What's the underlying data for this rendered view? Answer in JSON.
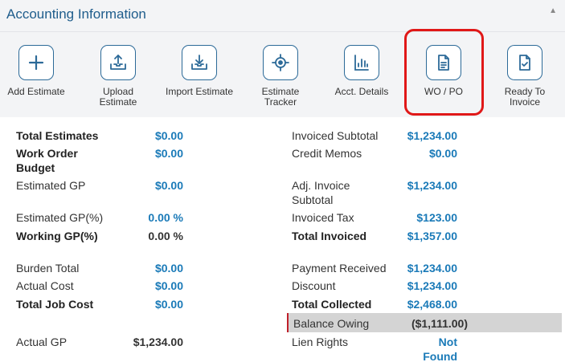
{
  "header": {
    "title": "Accounting Information",
    "collapse_icon": "caret-up-icon"
  },
  "toolbar": [
    {
      "label": "Add Estimate",
      "icon": "plus-icon"
    },
    {
      "label": "Upload Estimate",
      "icon": "upload-tray-icon"
    },
    {
      "label": "Import Estimate",
      "icon": "import-tray-icon"
    },
    {
      "label": "Estimate Tracker",
      "icon": "target-icon"
    },
    {
      "label": "Acct. Details",
      "icon": "bar-chart-icon"
    },
    {
      "label": "WO / PO",
      "icon": "document-icon"
    },
    {
      "label": "Ready To Invoice",
      "icon": "document-check-icon"
    }
  ],
  "left": {
    "total_estimates": {
      "label": "Total Estimates",
      "value": "$0.00"
    },
    "work_order_budget": {
      "label": "Work Order Budget",
      "value": "$0.00"
    },
    "estimated_gp": {
      "label": "Estimated GP",
      "value": "$0.00"
    },
    "estimated_gp_pct": {
      "label": "Estimated GP(%)",
      "value": "0.00 %"
    },
    "working_gp_pct": {
      "label": "Working GP(%)",
      "value": "0.00 %"
    },
    "burden_total": {
      "label": "Burden Total",
      "value": "$0.00"
    },
    "actual_cost": {
      "label": "Actual Cost",
      "value": "$0.00"
    },
    "total_job_cost": {
      "label": "Total Job Cost",
      "value": "$0.00"
    },
    "actual_gp": {
      "label": "Actual GP",
      "value": "$1,234.00"
    }
  },
  "right": {
    "invoiced_subtotal": {
      "label": "Invoiced Subtotal",
      "value": "$1,234.00"
    },
    "credit_memos": {
      "label": "Credit Memos",
      "value": "$0.00"
    },
    "adj_invoice_subtotal": {
      "label": "Adj. Invoice Subtotal",
      "value": "$1,234.00"
    },
    "invoiced_tax": {
      "label": "Invoiced Tax",
      "value": "$123.00"
    },
    "total_invoiced": {
      "label": "Total Invoiced",
      "value": "$1,357.00"
    },
    "payment_received": {
      "label": "Payment Received",
      "value": "$1,234.00"
    },
    "discount": {
      "label": "Discount",
      "value": "$1,234.00"
    },
    "total_collected": {
      "label": "Total Collected",
      "value": "$2,468.00"
    },
    "balance_owing": {
      "label": "Balance Owing",
      "value": "($1,111.00)"
    },
    "lien_rights": {
      "label": "Lien Rights",
      "value": "Not Found"
    }
  },
  "colors": {
    "accent": "#1f5d8c",
    "value_blue": "#1a7ab8",
    "highlight_red": "#e01818",
    "balance_bg": "#d4d4d4"
  }
}
